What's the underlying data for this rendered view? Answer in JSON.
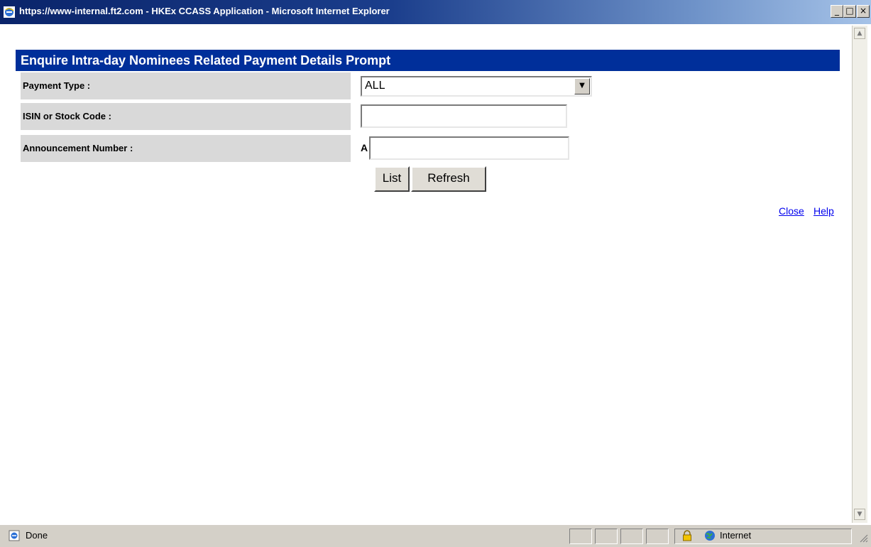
{
  "window": {
    "title": "https://www-internal.ft2.com - HKEx CCASS Application - Microsoft Internet Explorer",
    "minimize_icon": "_",
    "maximize_icon": "□",
    "close_icon": "×"
  },
  "form": {
    "heading": "Enquire Intra-day Nominees Related Payment Details Prompt",
    "payment_type_label": "Payment Type :",
    "payment_type_value": "ALL",
    "isin_label": "ISIN or Stock Code :",
    "isin_value": "",
    "announcement_label": "Announcement Number :",
    "announcement_prefix": "A",
    "announcement_value": "",
    "list_button": "List",
    "refresh_button": "Refresh",
    "close_link": "Close",
    "help_link": "Help"
  },
  "scrollbar": {
    "up_arrow": "▲",
    "down_arrow": "▼"
  },
  "statusbar": {
    "status_text": "Done",
    "zone_text": "Internet"
  },
  "colors": {
    "heading_bar": "#002f9a",
    "label_bg": "#d9d9d9",
    "link": "#0000ee",
    "chrome": "#d4d0c8"
  }
}
